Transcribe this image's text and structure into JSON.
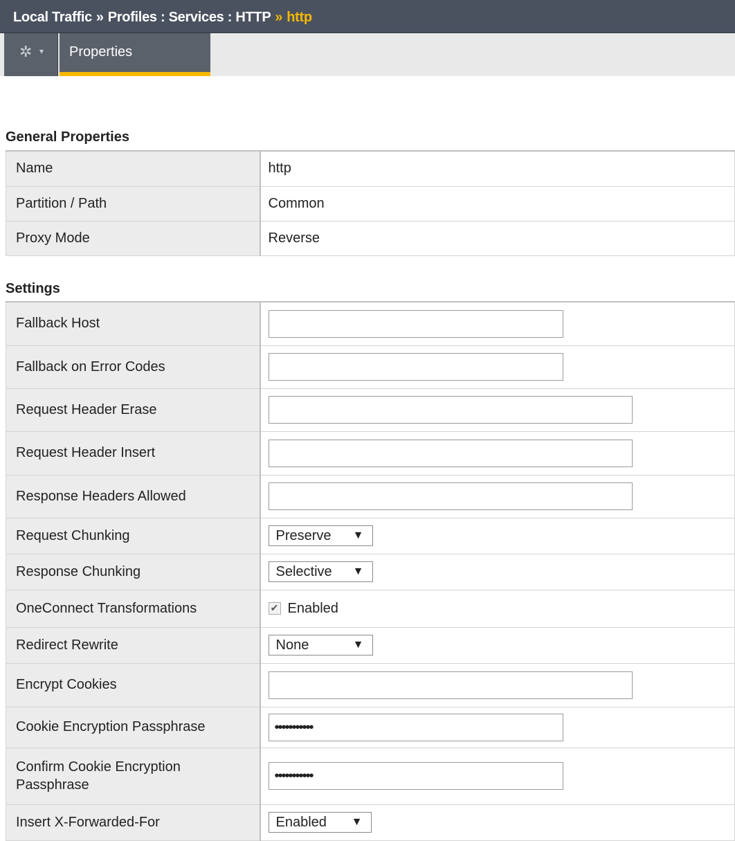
{
  "breadcrumb": {
    "part1": "Local Traffic",
    "sep1": "»",
    "part2": "Profiles : Services : HTTP",
    "sep2": "»",
    "current": "http"
  },
  "tabs": {
    "active": "Properties",
    "gear_icon": "gear-icon",
    "caret_icon": "chevron-down-icon"
  },
  "general": {
    "title": "General Properties",
    "rows": [
      {
        "label": "Name",
        "value": "http"
      },
      {
        "label": "Partition / Path",
        "value": "Common"
      },
      {
        "label": "Proxy Mode",
        "value": "Reverse"
      }
    ]
  },
  "settings": {
    "title": "Settings",
    "fallback_host": {
      "label": "Fallback Host",
      "value": ""
    },
    "fallback_error_codes": {
      "label": "Fallback on Error Codes",
      "value": ""
    },
    "request_header_erase": {
      "label": "Request Header Erase",
      "value": ""
    },
    "request_header_insert": {
      "label": "Request Header Insert",
      "value": ""
    },
    "response_headers_allowed": {
      "label": "Response Headers Allowed",
      "value": ""
    },
    "request_chunking": {
      "label": "Request Chunking",
      "value": "Preserve"
    },
    "response_chunking": {
      "label": "Response Chunking",
      "value": "Selective"
    },
    "oneconnect": {
      "label": "OneConnect Transformations",
      "checked": true,
      "text": "Enabled"
    },
    "redirect_rewrite": {
      "label": "Redirect Rewrite",
      "value": "None"
    },
    "encrypt_cookies": {
      "label": "Encrypt Cookies",
      "value": ""
    },
    "cookie_passphrase": {
      "label": "Cookie Encryption Passphrase",
      "value": "•••••••••••"
    },
    "confirm_passphrase": {
      "label": "Confirm Cookie Encryption Passphrase",
      "value": "•••••••••••"
    },
    "insert_xff": {
      "label": "Insert X-Forwarded-For",
      "value": "Enabled"
    }
  },
  "dropdown_arrow": "▼"
}
